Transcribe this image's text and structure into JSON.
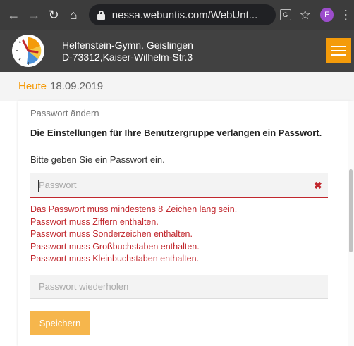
{
  "browser": {
    "url": "nessa.webuntis.com/WebUnt...",
    "profile_initial": "F",
    "icons": [
      "back-icon",
      "forward-icon",
      "reload-icon",
      "home-icon",
      "lock-icon",
      "translate-icon",
      "star-icon",
      "more-icon"
    ]
  },
  "school": {
    "name": "Helfenstein-Gymn. Geislingen",
    "address": "D-73312,Kaiser-Wilhelm-Str.3"
  },
  "date_bar": {
    "today_label": "Heute",
    "date": "18.09.2019"
  },
  "form": {
    "title": "Passwort ändern",
    "requirement": "Die Einstellungen für Ihre Benutzergruppe verlangen ein Passwort.",
    "prompt": "Bitte geben Sie ein Passwort ein.",
    "password_placeholder": "Passwort",
    "password_value": "",
    "repeat_placeholder": "Passwort wiederholen",
    "repeat_value": "",
    "errors": [
      "Das Passwort muss mindestens 8 Zeichen lang sein.",
      "Passwort muss Ziffern enthalten.",
      "Passwort muss Sonderzeichen enthalten.",
      "Passwort muss Großbuchstaben enthalten.",
      "Passwort muss Kleinbuchstaben enthalten."
    ],
    "save_label": "Speichern"
  },
  "colors": {
    "accent": "#f49b0a",
    "header_bg": "#414141",
    "error": "#c1272d",
    "button_bg": "#f6b64c"
  }
}
